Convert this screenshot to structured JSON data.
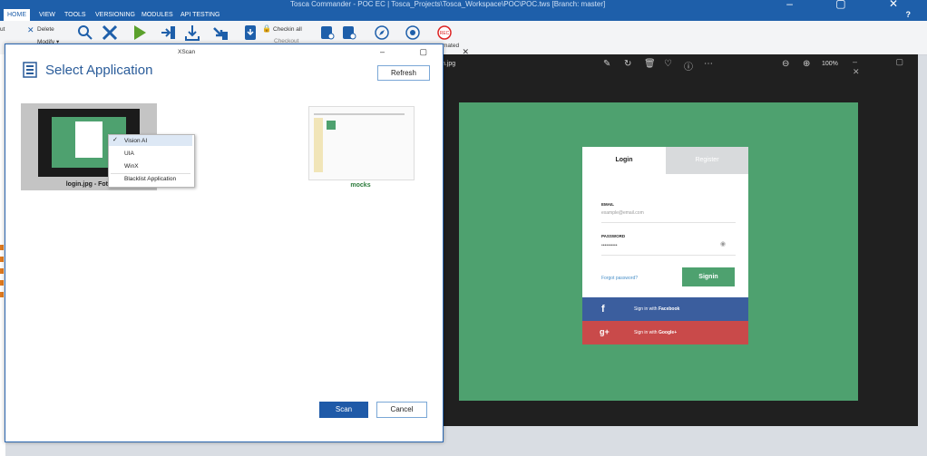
{
  "title_bar": {
    "text": "Tosca Commander - POC EC | Tosca_Projects\\Tosca_Workspace\\POC\\POC.tws [Branch: master]"
  },
  "ribbon": {
    "tabs": [
      "HOME",
      "VIEW",
      "TOOLS",
      "VERSIONING",
      "MODULES",
      "API TESTING"
    ],
    "active_tab": "HOME",
    "help": "?",
    "small_buttons": {
      "cut": "ut",
      "delete": "Delete",
      "modify": "Modify ▾",
      "checkin_all": "Checkin all",
      "checkout": "Checkout",
      "automated": "mated"
    }
  },
  "viewer": {
    "filename": "n.jpg",
    "zoom": "100%",
    "login_tab": "Login",
    "register_tab": "Register",
    "email_label": "EMAIL",
    "email_placeholder": "example@email.com",
    "password_label": "PASSWORD",
    "password_value": "••••••••••",
    "forgot": "Forgot password?",
    "signin": "Signin",
    "facebook_prefix": "Sign in with ",
    "facebook_brand": "Facebook",
    "google_prefix": "Sign in with ",
    "google_brand": "Google+",
    "facebook_icon": "f",
    "google_icon": "g+"
  },
  "dialog": {
    "window_title": "XScan",
    "heading": "Select Application",
    "refresh": "Refresh",
    "apps": [
      {
        "label": "login.jpg - Foto"
      },
      {
        "label": "mocks"
      }
    ],
    "context_menu": {
      "items": [
        "Vision AI",
        "UIA",
        "WinX",
        "Blacklist Application"
      ],
      "checked": "Vision AI"
    },
    "scan": "Scan",
    "cancel": "Cancel"
  },
  "colors": {
    "ribbon_blue": "#1e5faa",
    "green": "#4ea16f",
    "facebook": "#3b5e9e",
    "google": "#c94a4a",
    "scan_button": "#1f5aa8"
  }
}
